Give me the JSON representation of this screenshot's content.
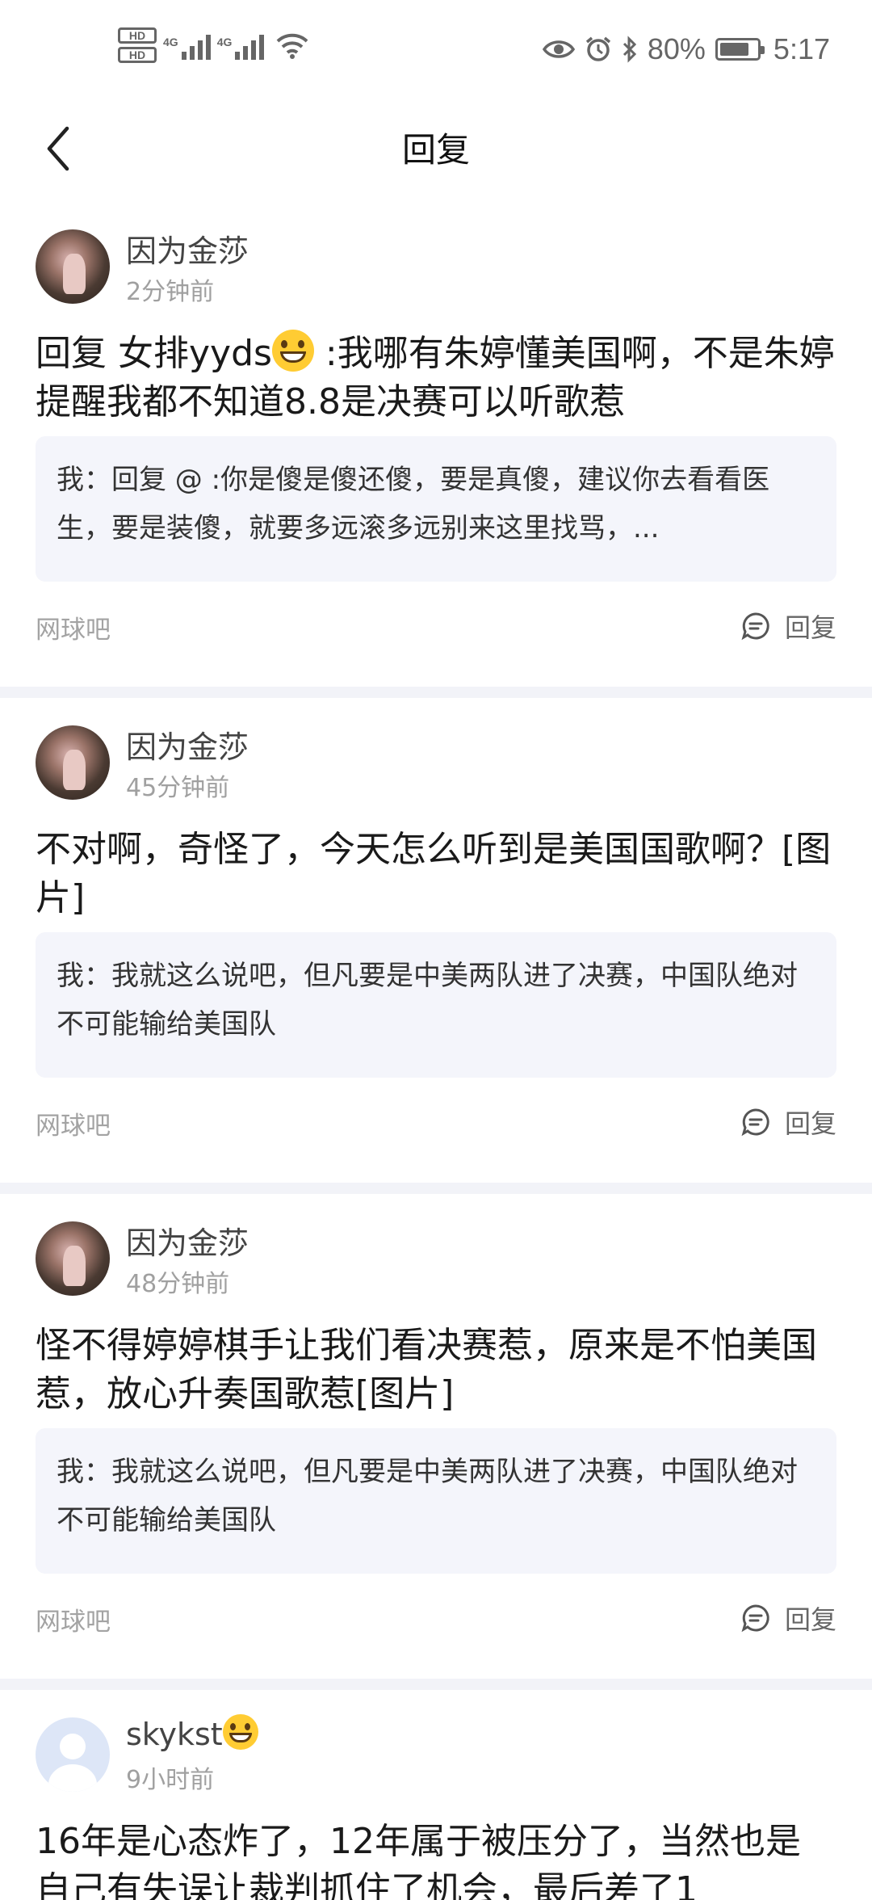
{
  "status_bar": {
    "hd1": "HD",
    "hd2": "HD",
    "net1": "4G",
    "net2": "4G",
    "battery_pct": "80%",
    "battery_level": 0.8,
    "time": "5:17"
  },
  "header": {
    "title": "回复"
  },
  "posts": [
    {
      "username": "因为金莎",
      "time": "2分钟前",
      "comment_pre": "回复 女排yyds",
      "comment_post": " :我哪有朱婷懂美国啊，不是朱婷提醒我都不知道8.8是决赛可以听歌惹",
      "quote": "我：回复 @ :你是傻是傻还傻，要是真傻，建议你去看看医生，要是装傻，就要多远滚多远别来这里找骂，...",
      "forum": "网球吧",
      "reply_label": "回复"
    },
    {
      "username": "因为金莎",
      "time": "45分钟前",
      "comment": "不对啊，奇怪了，今天怎么听到是美国国歌啊？[图片]",
      "quote": "我：我就这么说吧，但凡要是中美两队进了决赛，中国队绝对不可能输给美国队",
      "forum": "网球吧",
      "reply_label": "回复"
    },
    {
      "username": "因为金莎",
      "time": "48分钟前",
      "comment": "怪不得婷婷棋手让我们看决赛惹，原来是不怕美国惹，放心升奏国歌惹[图片]",
      "quote": "我：我就这么说吧，但凡要是中美两队进了决赛，中国队绝对不可能输给美国队",
      "forum": "网球吧",
      "reply_label": "回复"
    },
    {
      "username": "skykst",
      "time": "9小时前",
      "comment": "16年是心态炸了，12年属于被压分了，当然也是自己有失误让裁判抓住了机会，最后差了1"
    }
  ]
}
